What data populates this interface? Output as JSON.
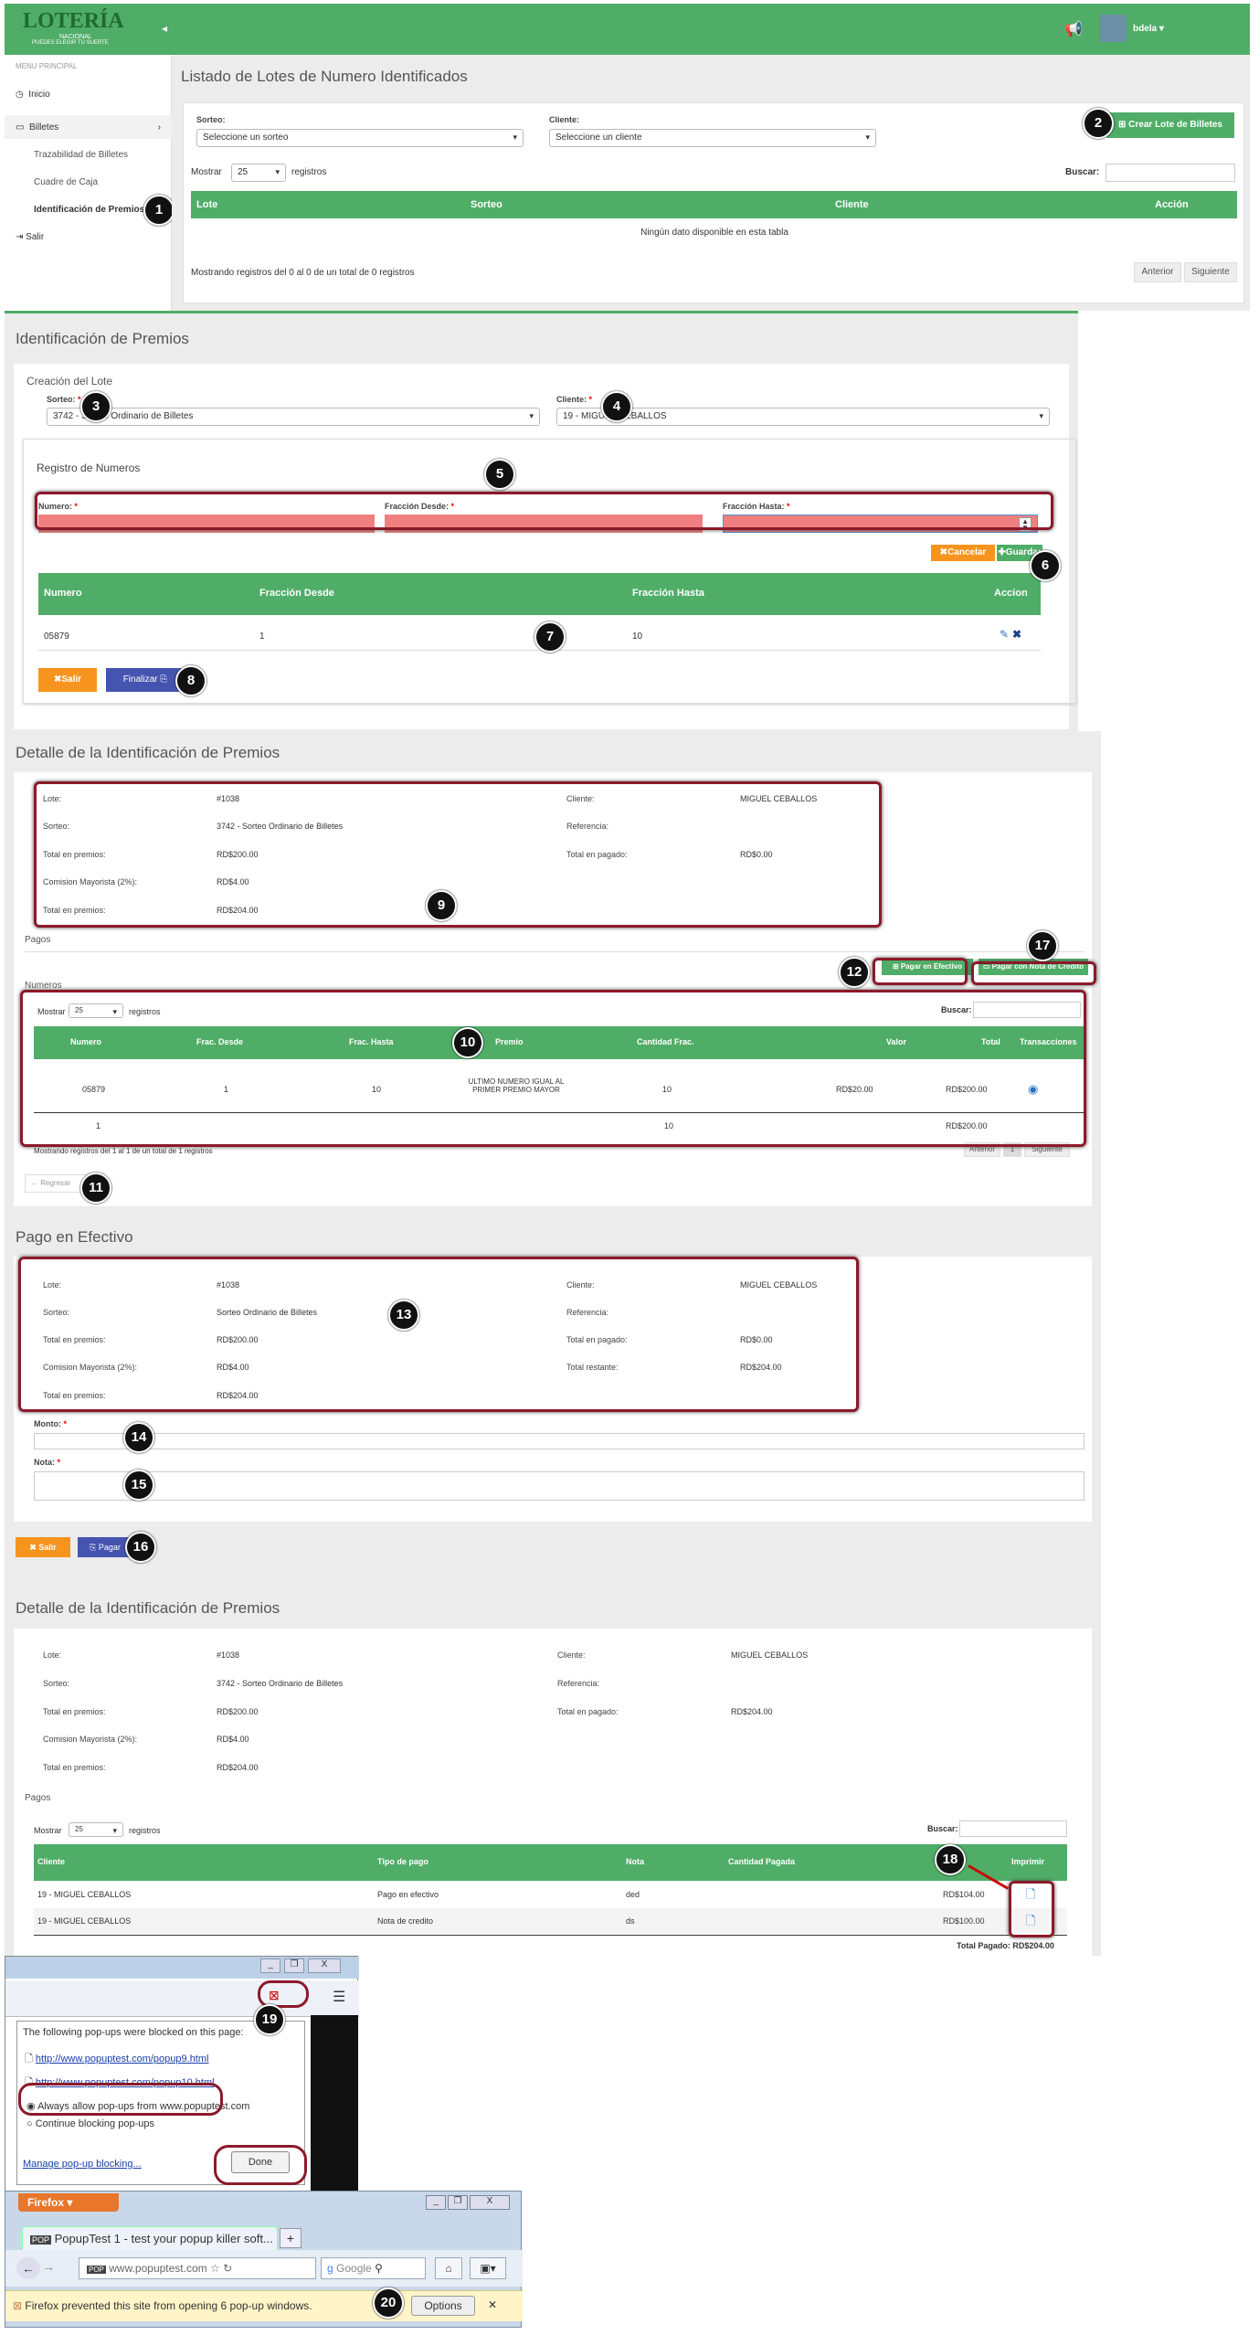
{
  "app": {
    "logo_text": "LOTERÍA",
    "logo_sub": "NACIONAL",
    "logo_tag": "PUEDES ELEGIR TU SUERTE",
    "user": "bdela",
    "colors": {
      "green": "#4fad67",
      "orange": "#f7941d",
      "blue": "#4554b0",
      "highlight": "#8b1a2b",
      "pink": "#f08080"
    }
  },
  "sidebar": {
    "heading": "MENU PRINCIPAL",
    "items": [
      {
        "label": "Inicio"
      },
      {
        "label": "Billetes"
      },
      {
        "label": "Trazabilidad de Billetes"
      },
      {
        "label": "Cuadre de Caja"
      },
      {
        "label": "Identificación de Premios"
      },
      {
        "label": "Salir"
      }
    ]
  },
  "list": {
    "title": "Listado de Lotes de Numero Identificados",
    "sorteo_label": "Sorteo:",
    "sorteo_placeholder": "Seleccione un sorteo",
    "cliente_label": "Cliente:",
    "cliente_placeholder": "Seleccione un cliente",
    "create_button": "Crear Lote de Billetes",
    "show_label": "Mostrar",
    "show_value": "25",
    "records_label": "registros",
    "search_label": "Buscar:",
    "columns": [
      "Lote",
      "Sorteo",
      "Cliente",
      "Acción"
    ],
    "empty_text": "Ningún dato disponible en esta tabla",
    "footer": "Mostrando registros del 0 al 0 de un total de 0 registros",
    "prev": "Anterior",
    "next": "Siguiente"
  },
  "ident": {
    "title": "Identificación de Premios",
    "subtitle": "Creación del Lote",
    "sorteo_label": "Sorteo:",
    "sorteo_value": "3742 - Sorteo Ordinario de Billetes",
    "cliente_label": "Cliente:",
    "cliente_value": "19 - MIGUEL CEBALLOS",
    "registro_title": "Registro de Numeros",
    "numero_label": "Numero:",
    "desde_label": "Fracción Desde:",
    "hasta_label": "Fracción Hasta:",
    "cancel_button": "Cancelar",
    "save_button": "Guardar",
    "columns": [
      "Numero",
      "Fracción Desde",
      "Fracción Hasta",
      "Accion"
    ],
    "row": {
      "numero": "05879",
      "desde": "1",
      "hasta": "10"
    },
    "exit_button": "Salir",
    "finish_button": "Finalizar"
  },
  "detail": {
    "title": "Detalle de la Identificación de Premios",
    "lote_label": "Lote:",
    "lote_value": "#1038",
    "sorteo_label": "Sorteo:",
    "sorteo_value": "3742 - Sorteo Ordinario de Billetes",
    "premios_label": "Total en premios:",
    "premios_value": "RD$200.00",
    "comision_label": "Comision Mayorista (2%):",
    "comision_value": "RD$4.00",
    "total_label": "Total en premios:",
    "total_value": "RD$204.00",
    "cliente_label": "Cliente:",
    "cliente_value": "MIGUEL CEBALLOS",
    "referencia_label": "Referencia:",
    "pagado_label": "Total en pagado:",
    "pagado_value": "RD$0.00",
    "pagos_label": "Pagos",
    "cash_button": "Pagar en Efectivo",
    "credit_button": "Pagar con Nota de Credito",
    "numeros_label": "Numeros",
    "show_label": "Mostrar",
    "show_value": "25",
    "records_label": "registros",
    "search_label": "Buscar:",
    "columns": [
      "Numero",
      "Frac. Desde",
      "Frac. Hasta",
      "Premio",
      "Cantidad Frac.",
      "Valor",
      "Total",
      "Transacciones"
    ],
    "row": {
      "numero": "05879",
      "desde": "1",
      "hasta": "10",
      "premio": "ULTIMO NUMERO IGUAL AL PRIMER PREMIO MAYOR",
      "cantidad": "10",
      "valor": "RD$20.00",
      "total": "RD$200.00"
    },
    "summary": {
      "numero": "1",
      "cantidad": "10",
      "total": "RD$200.00"
    },
    "footer": "Mostrando registros del 1 al 1 de un total de 1 registros",
    "prev": "Anterior",
    "page": "1",
    "next": "Siguiente",
    "back_button": "Regresar"
  },
  "cash": {
    "title": "Pago en Efectivo",
    "lote_label": "Lote:",
    "lote_value": "#1038",
    "sorteo_label": "Sorteo:",
    "sorteo_value": "Sorteo Ordinario de Billetes",
    "premios_label": "Total en premios:",
    "premios_value": "RD$200.00",
    "comision_label": "Comision Mayorista (2%):",
    "comision_value": "RD$4.00",
    "total_label": "Total en premios:",
    "total_value": "RD$204.00",
    "cliente_label": "Cliente:",
    "cliente_value": "MIGUEL CEBALLOS",
    "referencia_label": "Referencia:",
    "pagado_label": "Total en pagado:",
    "pagado_value": "RD$0.00",
    "restante_label": "Total restante:",
    "restante_value": "RD$204.00",
    "monto_label": "Monto:",
    "nota_label": "Nota:",
    "exit_button": "Salir",
    "pay_button": "Pagar"
  },
  "detail2": {
    "title": "Detalle de la Identificación de Premios",
    "lote_label": "Lote:",
    "lote_value": "#1038",
    "sorteo_label": "Sorteo:",
    "sorteo_value": "3742 - Sorteo Ordinario de Billetes",
    "premios_label": "Total en premios:",
    "premios_value": "RD$200.00",
    "comision_label": "Comision Mayorista (2%):",
    "comision_value": "RD$4.00",
    "total_label": "Total en premios:",
    "total_value": "RD$204.00",
    "cliente_label": "Cliente:",
    "cliente_value": "MIGUEL CEBALLOS",
    "referencia_label": "Referencia:",
    "pagado_label": "Total en pagado:",
    "pagado_value": "RD$204.00",
    "pagos_label": "Pagos",
    "show_label": "Mostrar",
    "show_value": "25",
    "records_label": "registros",
    "search_label": "Buscar:",
    "columns": [
      "Cliente",
      "Tipo de pago",
      "Nota",
      "Cantidad Pagada",
      "Imprimir"
    ],
    "rows": [
      {
        "cliente": "19 - MIGUEL CEBALLOS",
        "tipo": "Pago en efectivo",
        "nota": "ded",
        "cantidad": "RD$104.00"
      },
      {
        "cliente": "19 - MIGUEL CEBALLOS",
        "tipo": "Nota de credito",
        "nota": "ds",
        "cantidad": "RD$100.00"
      }
    ],
    "total_paid": "Total Pagado: RD$204.00"
  },
  "popup": {
    "heading": "The following pop-ups were blocked on this page:",
    "links": [
      "http://www.popuptest.com/popup9.html",
      "http://www.popuptest.com/popup10.html"
    ],
    "allow": "Always allow pop-ups from www.popuptest.com",
    "continue": "Continue blocking pop-ups",
    "manage": "Manage pop-up blocking...",
    "done": "Done"
  },
  "firefox": {
    "menu": "Firefox",
    "tab": "PopupTest 1 - test your popup killer soft...",
    "url": "www.popuptest.com",
    "search": "Google",
    "notice": "Firefox prevented this site from opening 6 pop-up windows.",
    "options": "Options"
  },
  "markers": [
    "1",
    "2",
    "3",
    "4",
    "5",
    "6",
    "7",
    "8",
    "9",
    "10",
    "11",
    "12",
    "13",
    "14",
    "15",
    "16",
    "17",
    "18",
    "19",
    "20"
  ]
}
